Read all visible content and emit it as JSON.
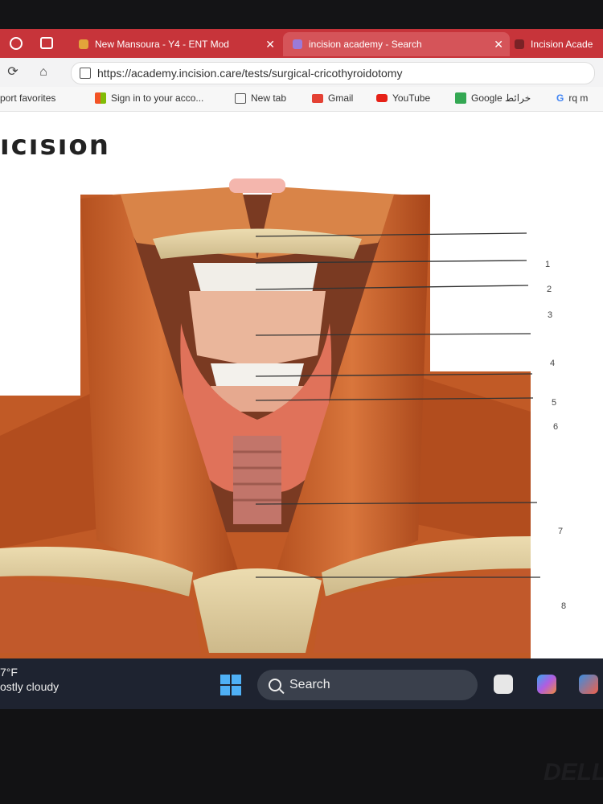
{
  "browser": {
    "tabs": [
      {
        "label": "New Mansoura - Y4 - ENT Mod",
        "favicon_color": "#e3a43a"
      },
      {
        "label": "incision academy - Search",
        "favicon_color": "#9b7ad8"
      },
      {
        "label": "Incision Acade",
        "favicon_color": "#7a2226"
      }
    ],
    "url": "https://academy.incision.care/tests/surgical-cricothyroidotomy",
    "favorites": [
      {
        "label": "port favorites"
      },
      {
        "label": "Sign in to your acco..."
      },
      {
        "label": "New tab"
      },
      {
        "label": "Gmail"
      },
      {
        "label": "YouTube"
      },
      {
        "label": "Google خرائط"
      },
      {
        "label": "rq m"
      }
    ],
    "accent": "#c7343a"
  },
  "page": {
    "logo": "ıcısıon",
    "figure_labels": [
      "1",
      "2",
      "3",
      "4",
      "5",
      "6",
      "7",
      "8"
    ]
  },
  "taskbar": {
    "temp": "7°F",
    "weather": "ostly cloudy",
    "search_label": "Search"
  },
  "bezel": {
    "brand": "DELL"
  }
}
